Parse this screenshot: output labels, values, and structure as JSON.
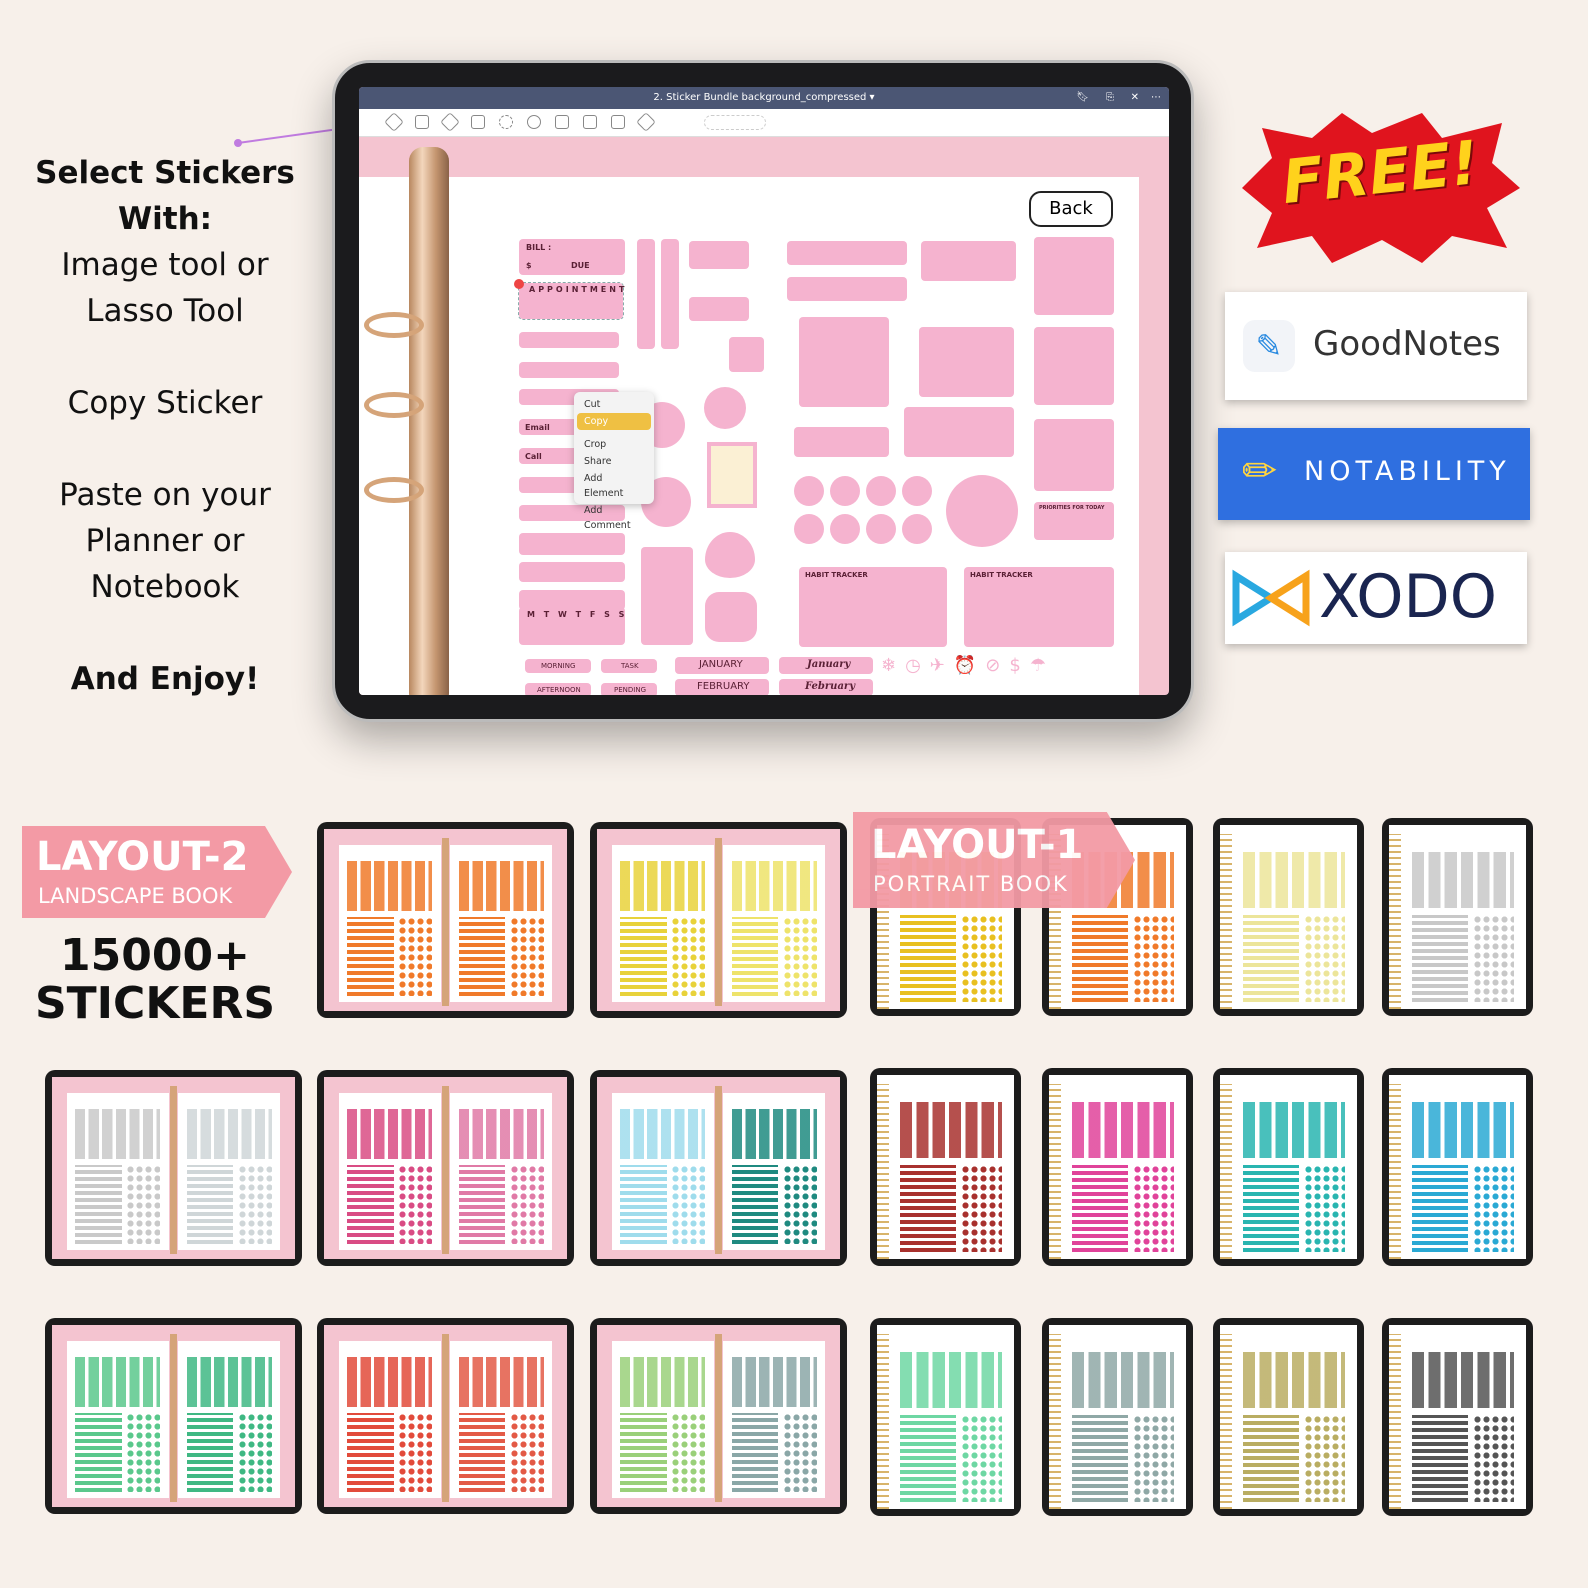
{
  "instructions": {
    "heading": "Select Stickers With:",
    "tools": "Image tool or Lasso Tool",
    "step2": "Copy Sticker",
    "step3": "Paste on your Planner or Notebook",
    "closing": "And Enjoy!"
  },
  "app": {
    "title": "2. Sticker Bundle background_compressed",
    "back_label": "Back",
    "context_menu": [
      "Cut",
      "Copy",
      "Crop",
      "Share",
      "Add Element",
      "Add Comment"
    ],
    "selected_menu_item": "Copy",
    "stickers": {
      "bill": "BILL :",
      "dollar": "$",
      "due": "DUE",
      "appointment": "APPOINTMENT",
      "email": "Email",
      "call": "Call",
      "week": "M T W T F S S",
      "habit1": "HABIT TRACKER",
      "habit2": "HABIT TRACKER",
      "priorities": "PRIORITIES FOR TODAY",
      "morning": "MORNING",
      "task": "TASK",
      "january": "JANUARY",
      "january_script": "January",
      "afternoon": "AFTERNOON",
      "pending": "PENDING",
      "february": "FEBRUARY",
      "february_script": "February"
    },
    "accent": "#f5b3cf"
  },
  "promo": {
    "free": "FREE!",
    "goodnotes": "GoodNotes",
    "notability": "NOTABILITY",
    "xodo": "XODO"
  },
  "layout2": {
    "title": "LAYOUT-2",
    "subtitle": "LANDSCAPE BOOK"
  },
  "layout1": {
    "title": "LAYOUT-1",
    "subtitle": "PORTRAIT BOOK"
  },
  "count": {
    "line1": "15000+",
    "line2": "STICKERS"
  },
  "landscape_colors": [
    [
      "#f07a2a",
      "#f07a2a"
    ],
    [
      "#e8d23a",
      "#eee36a"
    ],
    [
      "#c9c9c9",
      "#cfd6d8"
    ],
    [
      "#d94c84",
      "#e07aa6"
    ],
    [
      "#9fdcec",
      "#1f8a80"
    ],
    [
      "#5ac88c",
      "#3fb883"
    ],
    [
      "#e24b3b",
      "#e35a46"
    ],
    [
      "#9ad07a",
      "#8aa7a7"
    ]
  ],
  "portrait_colors": [
    "#e8c020",
    "#f07a2a",
    "#ece59a",
    "#c8c8c8",
    "#a8312e",
    "#e0439a",
    "#29b5b0",
    "#2aa9d4",
    "#6ed7a3",
    "#8fa8a6",
    "#b9ad62",
    "#555555"
  ]
}
